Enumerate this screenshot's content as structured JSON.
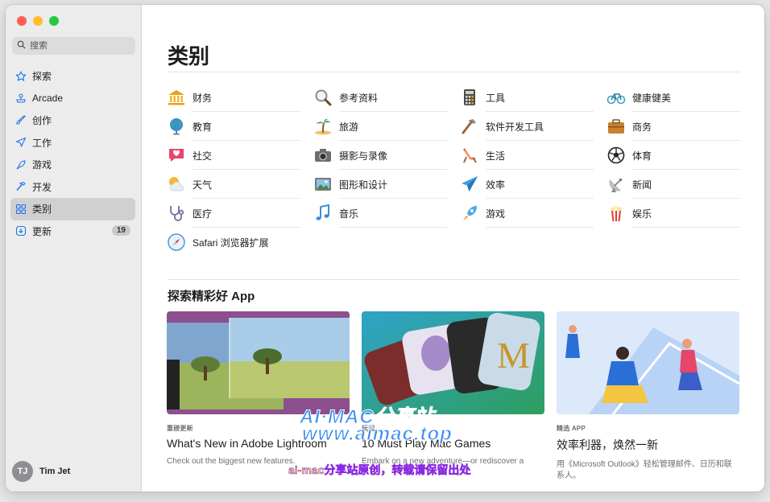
{
  "window": {
    "traffic_lights": {
      "close": "#ff5f57",
      "minimize": "#febc2e",
      "zoom": "#28c840"
    }
  },
  "sidebar": {
    "search_placeholder": "搜索",
    "items": [
      {
        "label": "探索",
        "icon": "star-icon"
      },
      {
        "label": "Arcade",
        "icon": "joystick-icon"
      },
      {
        "label": "创作",
        "icon": "brush-icon"
      },
      {
        "label": "工作",
        "icon": "paperplane-icon"
      },
      {
        "label": "游戏",
        "icon": "rocket-icon"
      },
      {
        "label": "开发",
        "icon": "hammer-icon"
      },
      {
        "label": "类别",
        "icon": "grid-icon",
        "active": true
      },
      {
        "label": "更新",
        "icon": "download-icon",
        "badge": "19"
      }
    ],
    "user": {
      "initials": "TJ",
      "name": "Tim Jet"
    }
  },
  "main": {
    "title": "类别",
    "categories": [
      {
        "label": "财务",
        "icon": "bank-icon"
      },
      {
        "label": "参考资料",
        "icon": "magnifier-icon"
      },
      {
        "label": "工具",
        "icon": "calculator-icon"
      },
      {
        "label": "健康健美",
        "icon": "bicycle-icon"
      },
      {
        "label": "教育",
        "icon": "globe-icon"
      },
      {
        "label": "旅游",
        "icon": "palm-tree-icon"
      },
      {
        "label": "软件开发工具",
        "icon": "hammer-icon"
      },
      {
        "label": "商务",
        "icon": "briefcase-icon"
      },
      {
        "label": "社交",
        "icon": "chat-heart-icon"
      },
      {
        "label": "摄影与录像",
        "icon": "camera-icon"
      },
      {
        "label": "生活",
        "icon": "beach-chair-icon"
      },
      {
        "label": "体育",
        "icon": "soccer-ball-icon"
      },
      {
        "label": "天气",
        "icon": "sun-cloud-icon"
      },
      {
        "label": "图形和设计",
        "icon": "picture-icon"
      },
      {
        "label": "效率",
        "icon": "paperplane-icon"
      },
      {
        "label": "新闻",
        "icon": "satellite-dish-icon"
      },
      {
        "label": "医疗",
        "icon": "stethoscope-icon"
      },
      {
        "label": "音乐",
        "icon": "music-note-icon"
      },
      {
        "label": "游戏",
        "icon": "rocket-icon"
      },
      {
        "label": "娱乐",
        "icon": "popcorn-icon"
      },
      {
        "label": "Safari 浏览器扩展",
        "icon": "compass-icon"
      }
    ],
    "section_title": "探索精彩好 App",
    "cards": [
      {
        "eyebrow": "重磅更新",
        "title": "What's New in Adobe Lightroom",
        "desc": "Check out the biggest new features."
      },
      {
        "eyebrow": "玩起",
        "title": "10 Must Play Mac Games",
        "desc": "Embark on a new adventure—or rediscover a"
      },
      {
        "eyebrow": "精选 APP",
        "title": "效率利器，焕然一新",
        "desc": "用《Microsoft Outlook》轻松管理邮件、日历和联系人。"
      }
    ]
  },
  "watermark": {
    "line1": "AI·MAC分享站",
    "line2": "www.aimac.top",
    "line3": "ai-mac分享站原创，转载请保留出处"
  }
}
